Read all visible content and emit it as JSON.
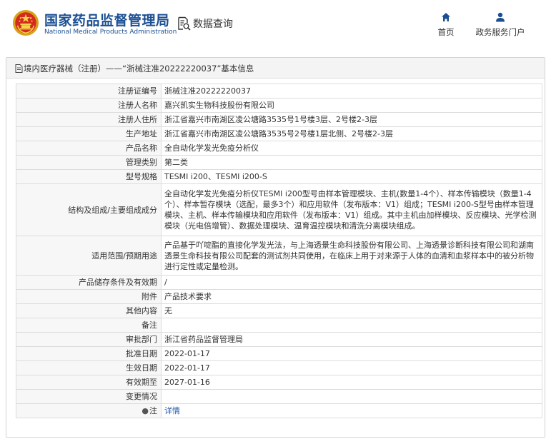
{
  "header": {
    "brand_cn": "国家药品监督管理局",
    "brand_en": "National Medical Products Administration",
    "data_query": "数据查询",
    "nav": {
      "home": "首页",
      "gov_portal": "政务服务门户"
    }
  },
  "panel": {
    "title": "境内医疗器械（注册）——“浙械注准20222220037”基本信息"
  },
  "rows": [
    {
      "label": "注册证编号",
      "value": "浙械注准20222220037"
    },
    {
      "label": "注册人名称",
      "value": "嘉兴凯实生物科技股份有限公司"
    },
    {
      "label": "注册人住所",
      "value": "浙江省嘉兴市南湖区凌公塘路3535号1号楼3层、2号楼2-3层"
    },
    {
      "label": "生产地址",
      "value": "浙江省嘉兴市南湖区凌公塘路3535号2号楼1层北侧、2号楼2-3层"
    },
    {
      "label": "产品名称",
      "value": "全自动化学发光免疫分析仪"
    },
    {
      "label": "管理类别",
      "value": "第二类"
    },
    {
      "label": "型号规格",
      "value": "TESMI i200、TESMI i200-S"
    },
    {
      "label": "结构及组成/主要组成成分",
      "value": "全自动化学发光免疫分析仪TESMI i200型号由样本管理模块、主机(数量1-4个）、样本传输模块（数量1-4个）、样本暂存模块（选配，最多3个）和应用软件（发布版本：V1）组成；TESMI i200-S型号由样本管理模块、主机、样本传输模块和应用软件（发布版本：V1）组成。其中主机由加样模块、反应模块、光学检测模块（光电倍增管）、数据处理模块、温育温控模块和清洗分离模块组成。"
    },
    {
      "label": "适用范围/预期用途",
      "value": "产品基于吖啶酯的直接化学发光法，与上海透景生命科技股份有限公司、上海透景诊断科技有限公司和湖南透景生命科技有限公司配套的测试剂共同使用，在临床上用于对来源于人体的血清和血浆样本中的被分析物进行定性或定量检测。"
    },
    {
      "label": "产品储存条件及有效期",
      "value": "/"
    },
    {
      "label": "附件",
      "value": "产品技术要求"
    },
    {
      "label": "其他内容",
      "value": "无"
    },
    {
      "label": "备注",
      "value": ""
    },
    {
      "label": "审批部门",
      "value": "浙江省药品监督管理局"
    },
    {
      "label": "批准日期",
      "value": "2022-01-17"
    },
    {
      "label": "生效日期",
      "value": "2022-01-17"
    },
    {
      "label": "有效期至",
      "value": "2027-01-16"
    },
    {
      "label": "变更情况",
      "value": ""
    },
    {
      "label": "注",
      "value": "详情"
    }
  ]
}
